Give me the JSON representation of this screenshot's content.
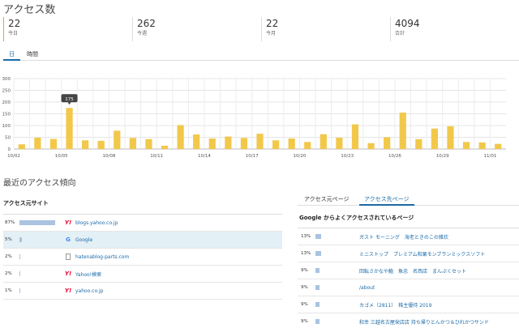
{
  "header": {
    "title": "アクセス数"
  },
  "stats": [
    {
      "value": "22",
      "label": "今日"
    },
    {
      "value": "262",
      "label": "今週"
    },
    {
      "value": "22",
      "label": "今月"
    },
    {
      "value": "4094",
      "label": "合計"
    }
  ],
  "tabs": [
    {
      "label": "日",
      "active": true
    },
    {
      "label": "時間",
      "active": false
    }
  ],
  "chart_data": {
    "type": "bar",
    "categories": [
      "10/02",
      "10/03",
      "10/04",
      "10/05",
      "10/06",
      "10/07",
      "10/08",
      "10/09",
      "10/10",
      "10/11",
      "10/12",
      "10/13",
      "10/14",
      "10/15",
      "10/16",
      "10/17",
      "10/18",
      "10/19",
      "10/20",
      "10/21",
      "10/22",
      "10/23",
      "10/24",
      "10/25",
      "10/26",
      "10/27",
      "10/28",
      "10/29",
      "10/30",
      "10/31",
      "11/01"
    ],
    "values": [
      20,
      48,
      43,
      175,
      37,
      35,
      78,
      47,
      42,
      14,
      102,
      62,
      45,
      53,
      47,
      65,
      37,
      45,
      30,
      63,
      48,
      105,
      25,
      50,
      155,
      42,
      87,
      97,
      30,
      28,
      22
    ],
    "xticks": [
      "10/02",
      "10/05",
      "10/08",
      "10/11",
      "10/14",
      "10/17",
      "10/20",
      "10/23",
      "10/26",
      "10/29",
      "11/01"
    ],
    "yticks": [
      0,
      50,
      100,
      150,
      200,
      250,
      300
    ],
    "ylim": [
      0,
      300
    ],
    "tooltip": {
      "category": "10/05",
      "value": "175"
    },
    "bar_color": "#f2c84b",
    "grid": true
  },
  "trend": {
    "title": "最近のアクセス傾向"
  },
  "sources": {
    "header": "アクセス元サイト",
    "rows": [
      {
        "pct": "87%",
        "ratio": 0.87,
        "icon": "yahoo-icon",
        "name": "blogs.yahoo.co.jp",
        "highlight": false
      },
      {
        "pct": "5%",
        "ratio": 0.05,
        "icon": "google-icon",
        "name": "Google",
        "highlight": true
      },
      {
        "pct": "2%",
        "ratio": 0.02,
        "icon": "document-icon",
        "name": "hatenablog-parts.com",
        "highlight": false
      },
      {
        "pct": "2%",
        "ratio": 0.02,
        "icon": "yahoo-icon",
        "name": "Yahoo!検索",
        "highlight": false
      },
      {
        "pct": "1%",
        "ratio": 0.01,
        "icon": "yahoo-icon",
        "name": "yahoo.co.jp",
        "highlight": false
      }
    ]
  },
  "pages": {
    "tabs": [
      {
        "label": "アクセス元ページ",
        "active": false
      },
      {
        "label": "アクセス先ページ",
        "active": true
      }
    ],
    "header": "Google からよくアクセスされているページ",
    "rows": [
      {
        "pct": "13%",
        "ratio": 0.13,
        "title": "ガスト モーニング　海老ときのこの雑炊"
      },
      {
        "pct": "13%",
        "ratio": 0.13,
        "title": "ミニストップ　プレミアム和栗モンブランミックスソフト"
      },
      {
        "pct": "9%",
        "ratio": 0.09,
        "title": "回転さかなや鮨　魚忠　名西店　まんぷくセット"
      },
      {
        "pct": "9%",
        "ratio": 0.09,
        "title": "/about"
      },
      {
        "pct": "9%",
        "ratio": 0.09,
        "title": "カゴメ（2811）　株主優待 2019"
      },
      {
        "pct": "9%",
        "ratio": 0.09,
        "title": "和幸 三越名古屋栄店店 持ち帰りとんかつ＆ひれかつサンド"
      }
    ]
  }
}
